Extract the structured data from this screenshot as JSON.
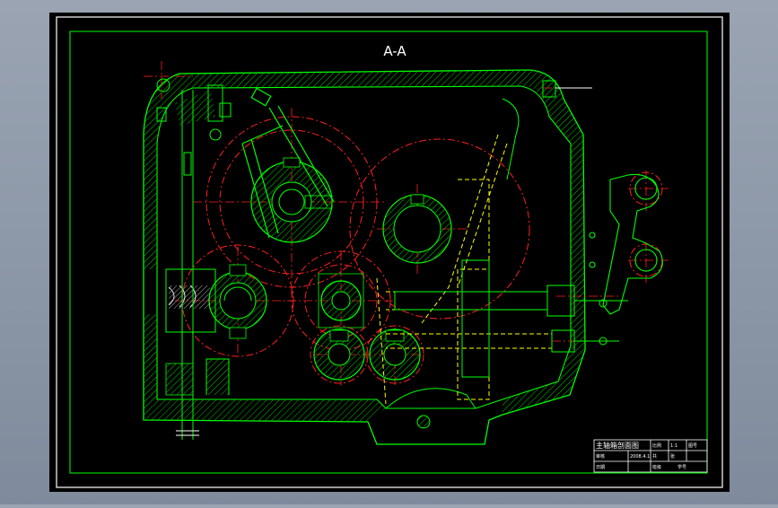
{
  "drawing": {
    "section_label": "A-A",
    "title_block": {
      "drawing_name": "主轴箱剖面图",
      "small_text": [
        "比例",
        "1:1",
        "图号",
        "共",
        "张",
        "审核",
        "日期",
        "2008.4.1",
        "班级",
        "学号"
      ]
    }
  },
  "colors": {
    "background": "#000000",
    "frame": "#ffffff",
    "outline": "#00ff00",
    "hatch": "#00ff00",
    "hidden": "#ffff00",
    "centerline": "#ff0000",
    "text": "#ffffff"
  }
}
